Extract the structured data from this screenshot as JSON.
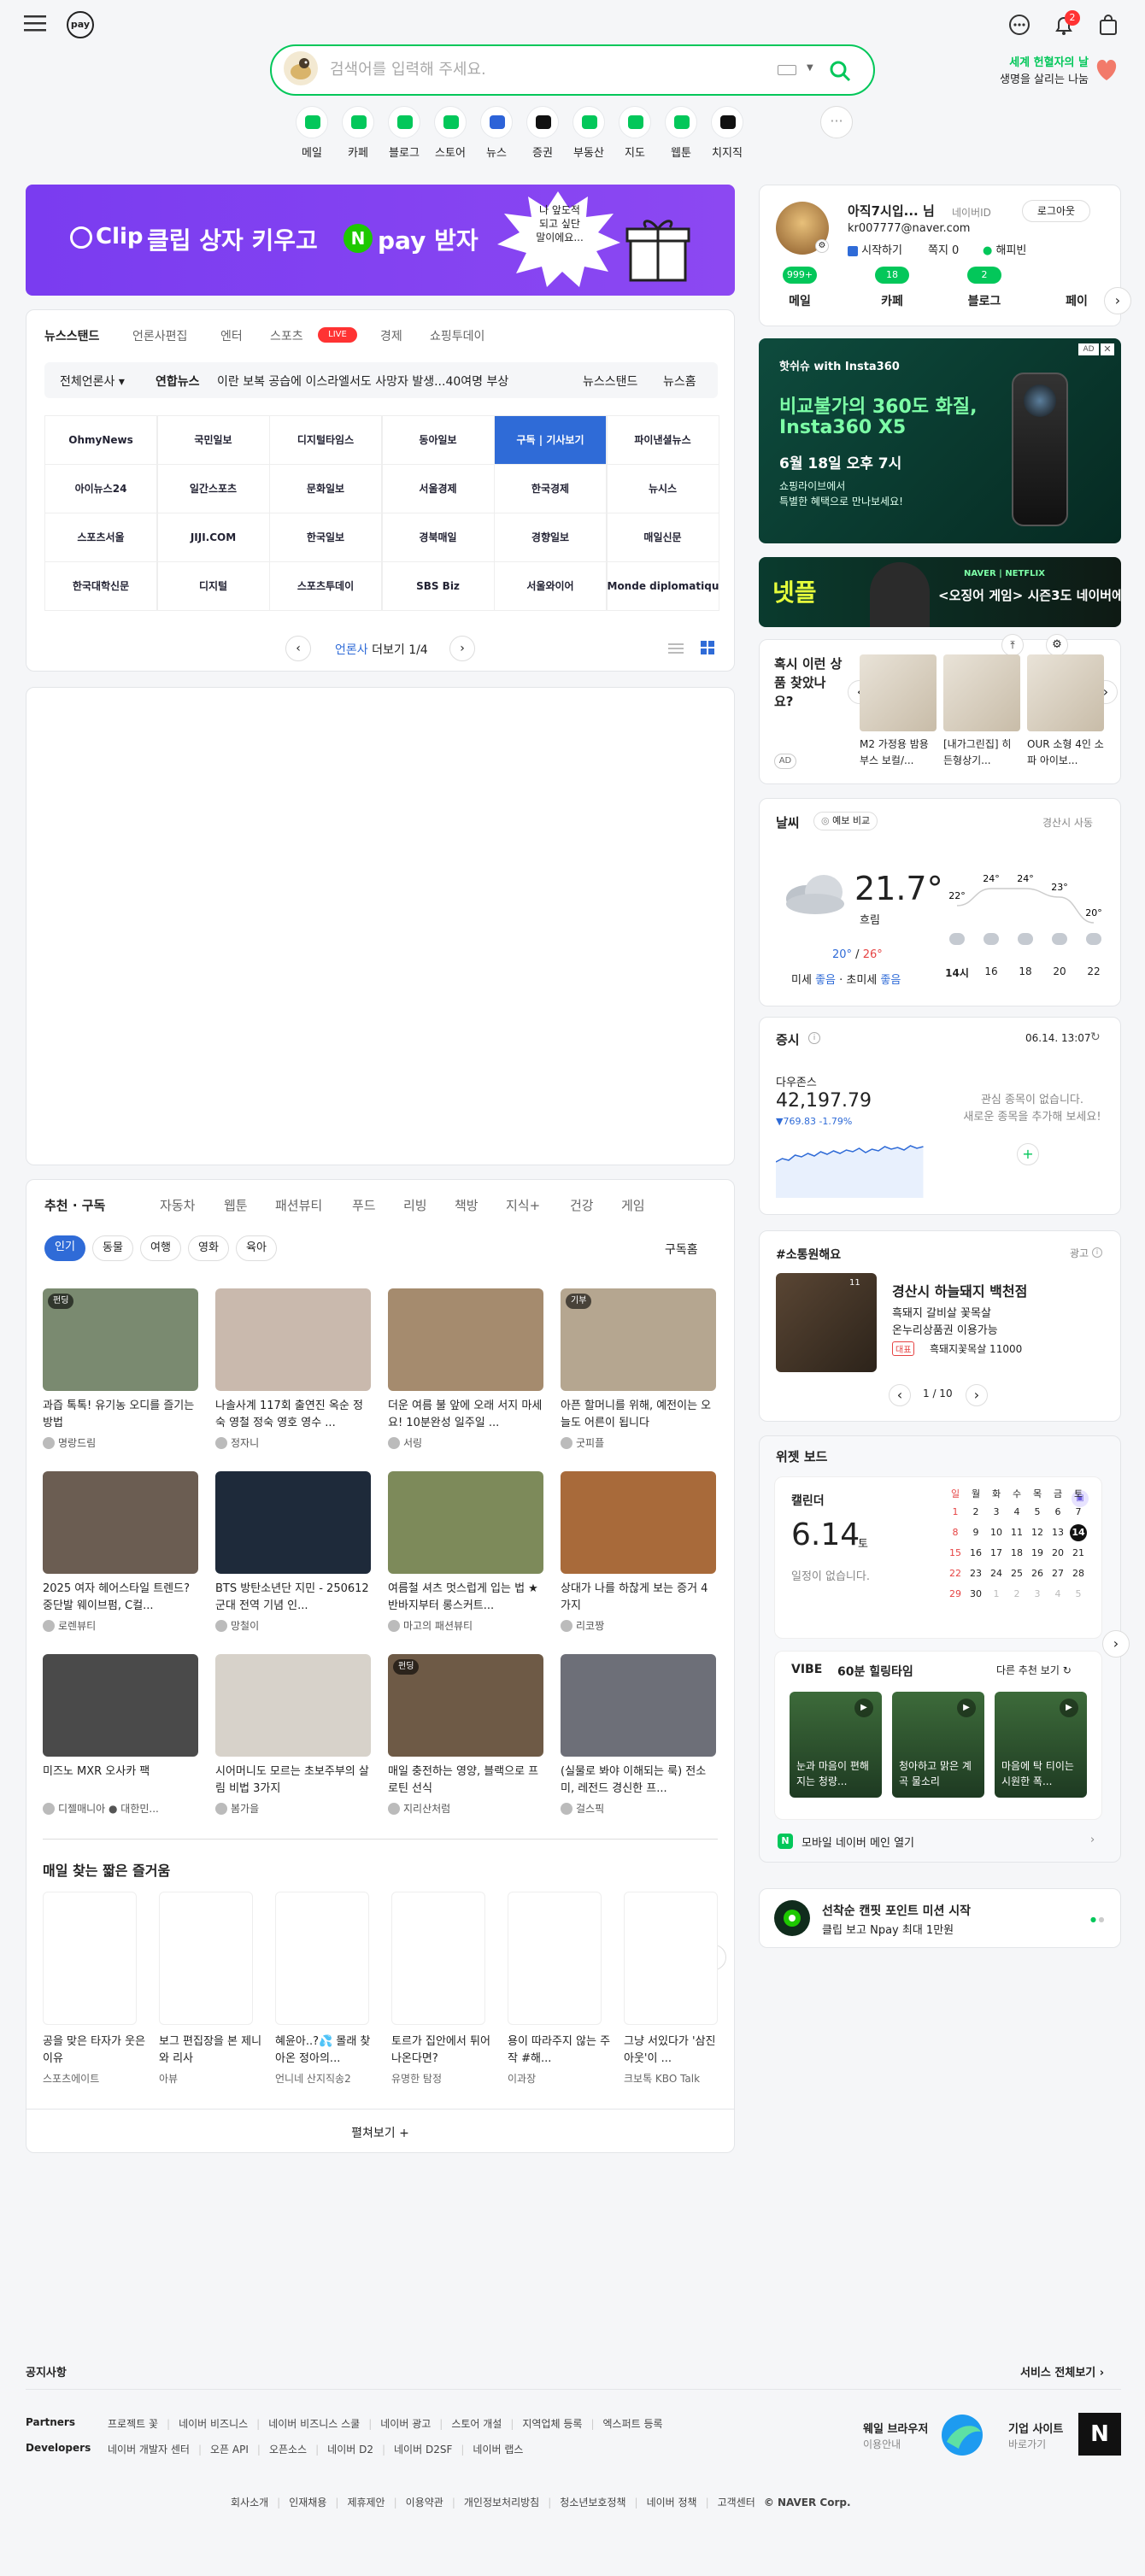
{
  "header": {
    "search_placeholder": "검색어를 입력해 주세요.",
    "promo_title": "세계 헌혈자의 날",
    "promo_sub": "생명을 살리는 나눔",
    "notif_count": "2",
    "service_logo": "pay"
  },
  "shortcuts": [
    {
      "label": "메일",
      "color": "#03c75a"
    },
    {
      "label": "카페",
      "color": "#03c75a"
    },
    {
      "label": "블로그",
      "color": "#03c75a"
    },
    {
      "label": "스토어",
      "color": "#03c75a"
    },
    {
      "label": "뉴스",
      "color": "#2d63d8"
    },
    {
      "label": "증권",
      "color": "#111111"
    },
    {
      "label": "부동산",
      "color": "#03c75a"
    },
    {
      "label": "지도",
      "color": "#03c75a"
    },
    {
      "label": "웹툰",
      "color": "#03c75a"
    },
    {
      "label": "치지직",
      "color": "#111111"
    }
  ],
  "top_banner": {
    "brand": "Clip",
    "text": "클립 상자 키우고",
    "text2": "pay 받자",
    "n": "N",
    "bubble": "나 앞도적\n되고 싶단\n말이에요..."
  },
  "news": {
    "tabs": [
      "뉴스스탠드",
      "언론사편집",
      "엔터",
      "스포츠",
      "경제",
      "쇼핑투데이"
    ],
    "live": "LIVE",
    "headline_source": "전체언론사",
    "headline_press": "연합뉴스",
    "headline": "이란 보복 공습에 이스라엘서도 사망자 발생...40여명 부상",
    "link1": "뉴스스탠드",
    "link2": "뉴스홈",
    "logos": [
      "OhmyNews",
      "국민일보",
      "디지털타임스",
      "동아일보",
      "구독 | 기사보기",
      "파이낸셜뉴스",
      "아이뉴스24",
      "일간스포츠",
      "문화일보",
      "서울경제",
      "한국경제",
      "뉴시스",
      "스포츠서울",
      "JIJI.COM",
      "한국일보",
      "경북매일",
      "경향일보",
      "매일신문",
      "한국대학신문",
      "디지털",
      "스포츠투데이",
      "SBS Biz",
      "서울와이어",
      "Monde diplomatique"
    ],
    "pager_label": "언론사",
    "pager_more": "더보기",
    "pager_page": "1/4"
  },
  "recommend": {
    "tabs": [
      "추천 · 구독",
      "자동차",
      "웹툰",
      "패션뷰티",
      "푸드",
      "리빙",
      "책방",
      "지식+",
      "건강",
      "게임"
    ],
    "chips": [
      "인기",
      "동물",
      "여행",
      "영화",
      "육아"
    ],
    "subscribe": "구독홈",
    "items": [
      {
        "title": "과즙 톡톡! 유기농 오디를 즐기는 방법",
        "author": "명랑드림",
        "badge": "펀딩",
        "bg": "#7a8a70"
      },
      {
        "title": "나솔사계 117회 출연진 옥순 정숙 영철 정숙 영호 영수 ...",
        "author": "정자니",
        "badge": "",
        "bg": "#c9b9ad"
      },
      {
        "title": "더운 여름 불 앞에 오래 서지 마세요! 10분완성 일주일 ...",
        "author": "서링",
        "badge": "",
        "bg": "#a58b6e"
      },
      {
        "title": "아픈 할머니를 위해, 예전이는 오늘도 어른이 됩니다",
        "author": "굿피플",
        "badge": "기부",
        "bg": "#b5a690"
      },
      {
        "title": "2025 여자 헤어스타일 트렌드? 중단발 웨이브펌, C컬...",
        "author": "로렌뷰티",
        "badge": "",
        "bg": "#6b5d52"
      },
      {
        "title": "BTS 방탄소년단 지민 - 250612 군대 전역 기념 인...",
        "author": "망철이",
        "badge": "",
        "bg": "#1e2a3a"
      },
      {
        "title": "여름철 셔츠 멋스럽게 입는 법 ★ 반바지부터 롱스커트...",
        "author": "마고의 패션뷰티",
        "badge": "",
        "bg": "#7d8a5a"
      },
      {
        "title": "상대가 나를 하찮게 보는 증거 4가지",
        "author": "리코짱",
        "badge": "",
        "bg": "#a86a3a"
      },
      {
        "title": "미즈노 MXR 오사카 팩",
        "author": "디젤매니아 ● 대한민...",
        "badge": "",
        "bg": "#4a4a4a"
      },
      {
        "title": "시어머니도 모르는 초보주부의 살림 비법 3가지",
        "author": "봄가을",
        "badge": "",
        "bg": "#d7d2ca"
      },
      {
        "title": "매일 충전하는 영양, 블랙으로 프로틴 선식",
        "author": "지리산처럼",
        "badge": "펀딩",
        "bg": "#6e5a46"
      },
      {
        "title": "(실물로 봐야 이해되는 룩) 전소미, 레전드 경신한 프...",
        "author": "걸스픽",
        "badge": "",
        "bg": "#6d6f78"
      }
    ],
    "short_title": "매일 찾는 짧은 즐거움",
    "shorts": [
      {
        "title": "공을 맞은 타자가 웃은 이유",
        "author": "스포츠에이트"
      },
      {
        "title": "보그 편집장을 본 제니와 리사",
        "author": "아뷰"
      },
      {
        "title": "혜윤아..?💦 몰래 찾아온 정아의...",
        "author": "언니네 산지직송2"
      },
      {
        "title": "토르가 집안에서 튀어나온다면?",
        "author": "유명한 탐정"
      },
      {
        "title": "용이 따라주지 않는 주작 #해...",
        "author": "이과장"
      },
      {
        "title": "그냥 서있다가 '삼진 아웃'이 ...",
        "author": "크보톡 KBO Talk"
      }
    ],
    "more": "펼쳐보기 +"
  },
  "profile": {
    "name": "아직7시입... 님",
    "naverid": "네이버ID",
    "logout": "로그아웃",
    "email": "kr007777@naver.com",
    "menu": [
      "시작하기",
      "쪽지 0",
      "해피빈"
    ],
    "tabs": [
      {
        "label": "메일",
        "count": "999+"
      },
      {
        "label": "카페",
        "count": "18"
      },
      {
        "label": "블로그",
        "count": "2"
      },
      {
        "label": "페이",
        "count": ""
      }
    ]
  },
  "ad1": {
    "brand": "핫쉬슈 with Insta360",
    "line1": "비교불가의 360도 화질,",
    "line2": "Insta360 X5",
    "line3": "6월 18일 오후 7시",
    "line4": "쇼핑라이브에서",
    "line5": "특별한 혜택으로 만나보세요!",
    "ad": "AD"
  },
  "ad2": {
    "text": "<오징어 게임> 시즌3도 네이버에",
    "sub": "NAVER | NETFLIX",
    "logo": "넷플"
  },
  "shopping": {
    "title": "혹시 이런 상품 찾았나요?",
    "ad": "AD",
    "items": [
      {
        "text": "M2 가정용 밤용부스 보컬/..."
      },
      {
        "text": "[내가그린집] 히든형상기..."
      },
      {
        "text": "OUR 소형 4인 소파 아이보..."
      }
    ]
  },
  "weather": {
    "title": "날씨",
    "compare": "예보 비교",
    "location": "경산시 사동",
    "temp": "21.7°",
    "cond": "흐림",
    "low": "20°",
    "high": "26°",
    "dust_label": "미세",
    "dust": "좋음",
    "ultra_label": "초미세",
    "ultra": "좋음",
    "hours": [
      {
        "h": "14시",
        "t": "22°"
      },
      {
        "h": "16",
        "t": "24°"
      },
      {
        "h": "18",
        "t": "24°"
      },
      {
        "h": "20",
        "t": "23°"
      },
      {
        "h": "22",
        "t": "20°"
      }
    ]
  },
  "stock": {
    "title": "증시",
    "time": "06.14. 13:07",
    "index": "다우존스",
    "value": "42,197.79",
    "change": "▼769.83 -1.79%",
    "empty1": "관심 종목이 없습니다.",
    "empty2": "새로운 종목을 추가해 보세요!",
    "add": "+"
  },
  "sosang": {
    "title": "#소통원해요",
    "ad": "광고",
    "store": "경산시 하늘돼지 백천점",
    "desc1": "흑돼지 갈비살 꽃목살",
    "desc2": "온누리상품권 이용가능",
    "tag": "대표",
    "score": "흑돼지꽃목살 11000",
    "count": "11",
    "page": "1 / 10"
  },
  "widget": {
    "title": "위젯 보드",
    "cal_label": "캘린더",
    "date": "6.14",
    "dow": "토",
    "empty": "일정이 없습니다.",
    "days": [
      "일",
      "월",
      "화",
      "수",
      "목",
      "금",
      "토"
    ],
    "grid": [
      [
        "1",
        "2",
        "3",
        "4",
        "5",
        "6",
        "7"
      ],
      [
        "8",
        "9",
        "10",
        "11",
        "12",
        "13",
        "14"
      ],
      [
        "15",
        "16",
        "17",
        "18",
        "19",
        "20",
        "21"
      ],
      [
        "22",
        "23",
        "24",
        "25",
        "26",
        "27",
        "28"
      ],
      [
        "29",
        "30",
        "1",
        "2",
        "3",
        "4",
        "5"
      ]
    ],
    "vibe": "VIBE",
    "vibe_title": "60분 힐링타임",
    "vibe_more": "다른 추천 보기",
    "vibe_items": [
      {
        "text": "눈과 마음이 편해지는 청량..."
      },
      {
        "text": "청아하고 맑은 계곡 물소리"
      },
      {
        "text": "마음에 탁 티이는 시원한 폭..."
      }
    ],
    "mobile": "모바일 네이버 메인 열기"
  },
  "mission": {
    "title": "선착순 캔핏 포인트 미션 시작",
    "sub": "클립 보고 Npay 최대 1만원"
  },
  "footer": {
    "notice": "공지사항",
    "all_services": "서비스 전체보기",
    "partners_label": "Partners",
    "partners": [
      "프로젝트 꽃",
      "네이버 비즈니스",
      "네이버 비즈니스 스쿨",
      "네이버 광고",
      "스토어 개설",
      "지역업체 등록",
      "엑스퍼트 등록"
    ],
    "dev_label": "Developers",
    "devs": [
      "네이버 개발자 센터",
      "오픈 API",
      "오픈소스",
      "네이버 D2",
      "네이버 D2SF",
      "네이버 랩스"
    ],
    "whale": "웨일 브라우저",
    "whale_sub": "이용안내",
    "biz": "기업 사이트",
    "biz_sub": "바로가기",
    "links": [
      "회사소개",
      "인재채용",
      "제휴제안",
      "이용약관",
      "개인정보처리방침",
      "청소년보호정책",
      "네이버 정책",
      "고객센터"
    ],
    "copyright": "© NAVER Corp."
  }
}
